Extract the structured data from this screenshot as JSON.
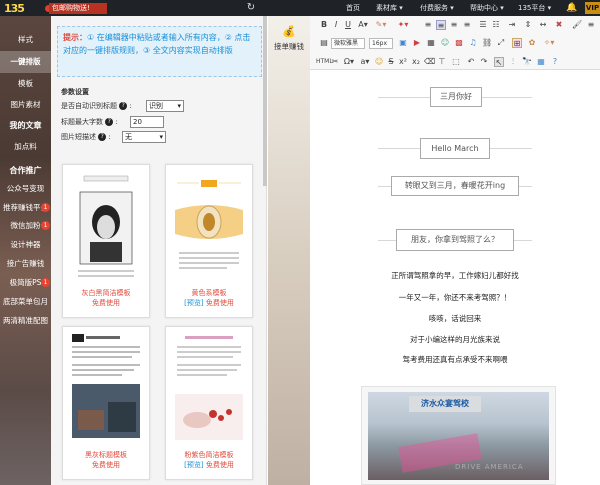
{
  "topbar": {
    "logo": "135",
    "promo": "包邮购物送!",
    "nav": [
      "首页",
      "素材库 ▾",
      "付费服务 ▾",
      "帮助中心 ▾",
      "135平台 ▾"
    ],
    "vip": "VIP"
  },
  "sidebar": {
    "items": [
      {
        "label": "样式",
        "active": false
      },
      {
        "label": "一键排版",
        "active": true
      },
      {
        "label": "模板",
        "active": false
      },
      {
        "label": "图片素材",
        "active": false
      },
      {
        "label": "我的文章",
        "active": false
      },
      {
        "label": "加点料",
        "active": false
      },
      {
        "label": "合作推广",
        "active": false
      },
      {
        "label": "公众号变现",
        "active": false
      },
      {
        "label": "推荐赚钱平台",
        "active": false
      },
      {
        "label": "微信加粉",
        "active": false
      },
      {
        "label": "设计神器",
        "active": false
      },
      {
        "label": "接广告赚钱",
        "active": false
      },
      {
        "label": "极简版PS",
        "active": false
      },
      {
        "label": "底部菜单包月",
        "active": false
      },
      {
        "label": "两清精准配图",
        "active": false
      }
    ]
  },
  "tip": {
    "prefix": "提示：",
    "text": "① 在编辑器中粘贴或者输入所有内容，② 点击对应的一键排版规则，③ 全文内容实现自动排版"
  },
  "params": {
    "title": "参数设置",
    "auto_title_label": "是否自动识别标题",
    "auto_title_value": "识别",
    "max_chars_label": "标题最大字数",
    "max_chars_value": "20",
    "img_desc_label": "图片短描述",
    "img_desc_value": "无"
  },
  "templates": [
    {
      "name": "灰白黑简洁模板",
      "tag": "",
      "usage": "免费使用"
    },
    {
      "name": "黄色系模板",
      "tag": "[预览]",
      "usage": "免费使用"
    },
    {
      "name": "黑灰标题模板",
      "tag": "",
      "usage": "免费使用"
    },
    {
      "name": "粉紫色简洁模板",
      "tag": "[预览]",
      "usage": "免费使用"
    }
  ],
  "toolcol": {
    "label": "接单赚钱"
  },
  "toolbar": {
    "font_family": "微软雅黑",
    "font_size": "16px"
  },
  "document": {
    "boxes": [
      "三月你好",
      "Hello March",
      "转眼又到三月，春暖花开ing",
      "朋友，你拿到驾照了么？"
    ],
    "paragraphs": [
      "正所谓驾照拿的早，工作嫁妇儿都好找",
      "一年又一年，你还不来考驾照？！",
      "咳咳，话说回来",
      "对于小编这样的月光族来说",
      "驾考费用还真有点承受不来啊喂"
    ],
    "photo_sign": "济水众宴驾校",
    "watermark": "DRIVE AMERICA"
  },
  "colors": {
    "accent": "#e04a3b",
    "blue": "#1a8fd6"
  }
}
